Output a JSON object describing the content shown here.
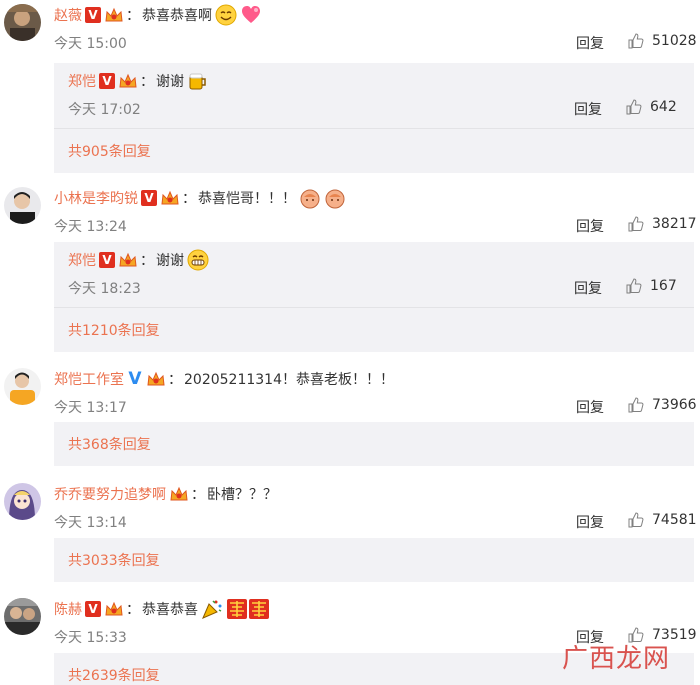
{
  "actions": {
    "reply_label": "回复"
  },
  "comments": [
    {
      "user": "赵薇",
      "text": "恭喜恭喜啊",
      "time": "今天 15:00",
      "likes": "51028",
      "reply": {
        "user": "郑恺",
        "text": "谢谢",
        "time": "今天 17:02",
        "likes": "642"
      },
      "more": "共905条回复"
    },
    {
      "user": "小林是李昀锐",
      "text": "恭喜恺哥！！！",
      "time": "今天 13:24",
      "likes": "38217",
      "reply": {
        "user": "郑恺",
        "text": "谢谢",
        "time": "今天 18:23",
        "likes": "167"
      },
      "more": "共1210条回复"
    },
    {
      "user": "郑恺工作室",
      "text": "20205211314！恭喜老板！！！",
      "time": "今天 13:17",
      "likes": "73966",
      "more": "共368条回复"
    },
    {
      "user": "乔乔要努力追梦啊",
      "text": "卧槽？？？",
      "time": "今天 13:14",
      "likes": "74581",
      "more": "共3033条回复"
    },
    {
      "user": "陈赫",
      "text": "恭喜恭喜",
      "time": "今天 15:33",
      "likes": "73519",
      "more": "共2639条回复"
    }
  ],
  "colors": {
    "username": "#eb7350",
    "reply_bg": "#f2f2f5",
    "badge_red": "#e02f1f",
    "badge_blue": "#2d8cf0"
  },
  "watermark": {
    "text": "广西龙网"
  }
}
